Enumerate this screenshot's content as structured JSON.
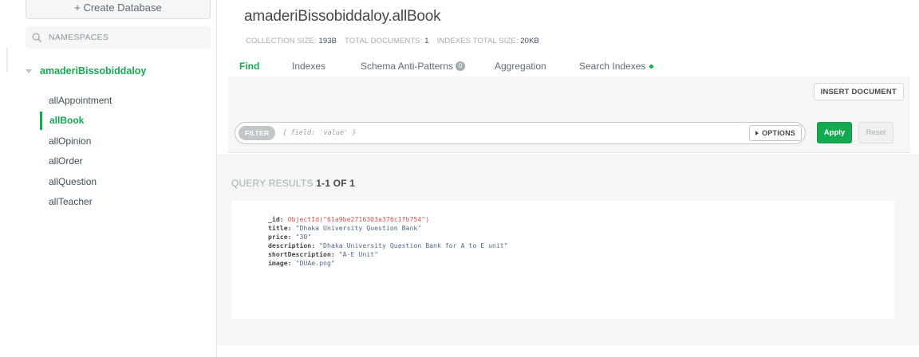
{
  "sidebar": {
    "create_db_label": "+ Create Database",
    "search_placeholder": "NAMESPACES",
    "database": "amaderiBissobiddaloy",
    "collections": [
      {
        "name": "allAppointment",
        "active": false
      },
      {
        "name": "allBook",
        "active": true
      },
      {
        "name": "allOpinion",
        "active": false
      },
      {
        "name": "allOrder",
        "active": false
      },
      {
        "name": "allQuestion",
        "active": false
      },
      {
        "name": "allTeacher",
        "active": false
      }
    ]
  },
  "header": {
    "title": "amaderiBissobiddaloy.allBook",
    "stats": [
      {
        "label": "COLLECTION SIZE:",
        "value": "193B"
      },
      {
        "label": "TOTAL DOCUMENTS:",
        "value": "1"
      },
      {
        "label": "INDEXES TOTAL SIZE:",
        "value": "20KB"
      }
    ]
  },
  "tabs": [
    {
      "label": "Find",
      "active": true
    },
    {
      "label": "Indexes"
    },
    {
      "label": "Schema Anti-Patterns",
      "count": "0"
    },
    {
      "label": "Aggregation"
    },
    {
      "label": "Search Indexes",
      "dot": true
    }
  ],
  "toolbar": {
    "insert_label": "INSERT DOCUMENT",
    "filter_label": "FILTER",
    "filter_placeholder": "{ field: 'value' }",
    "options_label": "OPTIONS",
    "apply_label": "Apply",
    "reset_label": "Reset"
  },
  "results": {
    "label": "QUERY RESULTS",
    "range": "1-1 OF 1",
    "document": [
      {
        "key": "_id",
        "value": "ObjectId(\"61a9be2716303a376c1fb754\")",
        "type": "oid"
      },
      {
        "key": "title",
        "value": "\"Dhaka University Question Bank\"",
        "type": "str"
      },
      {
        "key": "price",
        "value": "\"30\"",
        "type": "str"
      },
      {
        "key": "description",
        "value": "\"Dhaka University Question Bank for A to E unit\"",
        "type": "str"
      },
      {
        "key": "shortDescription",
        "value": "\"A-E Unit\"",
        "type": "str"
      },
      {
        "key": "image",
        "value": "\"DUAe.png\"",
        "type": "str"
      }
    ]
  },
  "colors": {
    "accent": "#13aa52",
    "oid": "#d9534f",
    "string": "#4e6b8a"
  }
}
